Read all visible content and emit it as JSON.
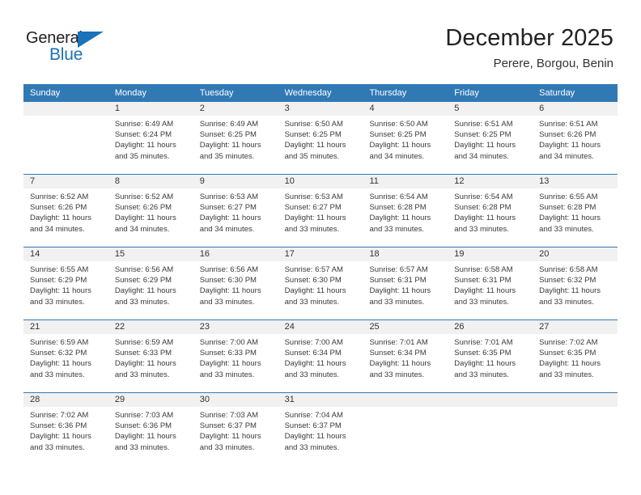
{
  "logo": {
    "word_one": "General",
    "word_two": "Blue",
    "triangle_icon": "blue-triangle-icon",
    "accent_color": "#1a72b8",
    "dark_color": "#231f20"
  },
  "header": {
    "title": "December 2025",
    "subtitle": "Perere, Borgou, Benin"
  },
  "calendar": {
    "header_bg": "#3179b5",
    "day_number_bg": "#f1f1f1",
    "weekdays": [
      "Sunday",
      "Monday",
      "Tuesday",
      "Wednesday",
      "Thursday",
      "Friday",
      "Saturday"
    ],
    "weeks": [
      [
        {
          "day": "",
          "empty": true,
          "sunrise": "",
          "sunset": "",
          "daylight": ""
        },
        {
          "day": "1",
          "empty": false,
          "sunrise": "Sunrise: 6:49 AM",
          "sunset": "Sunset: 6:24 PM",
          "daylight": "Daylight: 11 hours and 35 minutes."
        },
        {
          "day": "2",
          "empty": false,
          "sunrise": "Sunrise: 6:49 AM",
          "sunset": "Sunset: 6:25 PM",
          "daylight": "Daylight: 11 hours and 35 minutes."
        },
        {
          "day": "3",
          "empty": false,
          "sunrise": "Sunrise: 6:50 AM",
          "sunset": "Sunset: 6:25 PM",
          "daylight": "Daylight: 11 hours and 35 minutes."
        },
        {
          "day": "4",
          "empty": false,
          "sunrise": "Sunrise: 6:50 AM",
          "sunset": "Sunset: 6:25 PM",
          "daylight": "Daylight: 11 hours and 34 minutes."
        },
        {
          "day": "5",
          "empty": false,
          "sunrise": "Sunrise: 6:51 AM",
          "sunset": "Sunset: 6:25 PM",
          "daylight": "Daylight: 11 hours and 34 minutes."
        },
        {
          "day": "6",
          "empty": false,
          "sunrise": "Sunrise: 6:51 AM",
          "sunset": "Sunset: 6:26 PM",
          "daylight": "Daylight: 11 hours and 34 minutes."
        }
      ],
      [
        {
          "day": "7",
          "empty": false,
          "sunrise": "Sunrise: 6:52 AM",
          "sunset": "Sunset: 6:26 PM",
          "daylight": "Daylight: 11 hours and 34 minutes."
        },
        {
          "day": "8",
          "empty": false,
          "sunrise": "Sunrise: 6:52 AM",
          "sunset": "Sunset: 6:26 PM",
          "daylight": "Daylight: 11 hours and 34 minutes."
        },
        {
          "day": "9",
          "empty": false,
          "sunrise": "Sunrise: 6:53 AM",
          "sunset": "Sunset: 6:27 PM",
          "daylight": "Daylight: 11 hours and 34 minutes."
        },
        {
          "day": "10",
          "empty": false,
          "sunrise": "Sunrise: 6:53 AM",
          "sunset": "Sunset: 6:27 PM",
          "daylight": "Daylight: 11 hours and 33 minutes."
        },
        {
          "day": "11",
          "empty": false,
          "sunrise": "Sunrise: 6:54 AM",
          "sunset": "Sunset: 6:28 PM",
          "daylight": "Daylight: 11 hours and 33 minutes."
        },
        {
          "day": "12",
          "empty": false,
          "sunrise": "Sunrise: 6:54 AM",
          "sunset": "Sunset: 6:28 PM",
          "daylight": "Daylight: 11 hours and 33 minutes."
        },
        {
          "day": "13",
          "empty": false,
          "sunrise": "Sunrise: 6:55 AM",
          "sunset": "Sunset: 6:28 PM",
          "daylight": "Daylight: 11 hours and 33 minutes."
        }
      ],
      [
        {
          "day": "14",
          "empty": false,
          "sunrise": "Sunrise: 6:55 AM",
          "sunset": "Sunset: 6:29 PM",
          "daylight": "Daylight: 11 hours and 33 minutes."
        },
        {
          "day": "15",
          "empty": false,
          "sunrise": "Sunrise: 6:56 AM",
          "sunset": "Sunset: 6:29 PM",
          "daylight": "Daylight: 11 hours and 33 minutes."
        },
        {
          "day": "16",
          "empty": false,
          "sunrise": "Sunrise: 6:56 AM",
          "sunset": "Sunset: 6:30 PM",
          "daylight": "Daylight: 11 hours and 33 minutes."
        },
        {
          "day": "17",
          "empty": false,
          "sunrise": "Sunrise: 6:57 AM",
          "sunset": "Sunset: 6:30 PM",
          "daylight": "Daylight: 11 hours and 33 minutes."
        },
        {
          "day": "18",
          "empty": false,
          "sunrise": "Sunrise: 6:57 AM",
          "sunset": "Sunset: 6:31 PM",
          "daylight": "Daylight: 11 hours and 33 minutes."
        },
        {
          "day": "19",
          "empty": false,
          "sunrise": "Sunrise: 6:58 AM",
          "sunset": "Sunset: 6:31 PM",
          "daylight": "Daylight: 11 hours and 33 minutes."
        },
        {
          "day": "20",
          "empty": false,
          "sunrise": "Sunrise: 6:58 AM",
          "sunset": "Sunset: 6:32 PM",
          "daylight": "Daylight: 11 hours and 33 minutes."
        }
      ],
      [
        {
          "day": "21",
          "empty": false,
          "sunrise": "Sunrise: 6:59 AM",
          "sunset": "Sunset: 6:32 PM",
          "daylight": "Daylight: 11 hours and 33 minutes."
        },
        {
          "day": "22",
          "empty": false,
          "sunrise": "Sunrise: 6:59 AM",
          "sunset": "Sunset: 6:33 PM",
          "daylight": "Daylight: 11 hours and 33 minutes."
        },
        {
          "day": "23",
          "empty": false,
          "sunrise": "Sunrise: 7:00 AM",
          "sunset": "Sunset: 6:33 PM",
          "daylight": "Daylight: 11 hours and 33 minutes."
        },
        {
          "day": "24",
          "empty": false,
          "sunrise": "Sunrise: 7:00 AM",
          "sunset": "Sunset: 6:34 PM",
          "daylight": "Daylight: 11 hours and 33 minutes."
        },
        {
          "day": "25",
          "empty": false,
          "sunrise": "Sunrise: 7:01 AM",
          "sunset": "Sunset: 6:34 PM",
          "daylight": "Daylight: 11 hours and 33 minutes."
        },
        {
          "day": "26",
          "empty": false,
          "sunrise": "Sunrise: 7:01 AM",
          "sunset": "Sunset: 6:35 PM",
          "daylight": "Daylight: 11 hours and 33 minutes."
        },
        {
          "day": "27",
          "empty": false,
          "sunrise": "Sunrise: 7:02 AM",
          "sunset": "Sunset: 6:35 PM",
          "daylight": "Daylight: 11 hours and 33 minutes."
        }
      ],
      [
        {
          "day": "28",
          "empty": false,
          "sunrise": "Sunrise: 7:02 AM",
          "sunset": "Sunset: 6:36 PM",
          "daylight": "Daylight: 11 hours and 33 minutes."
        },
        {
          "day": "29",
          "empty": false,
          "sunrise": "Sunrise: 7:03 AM",
          "sunset": "Sunset: 6:36 PM",
          "daylight": "Daylight: 11 hours and 33 minutes."
        },
        {
          "day": "30",
          "empty": false,
          "sunrise": "Sunrise: 7:03 AM",
          "sunset": "Sunset: 6:37 PM",
          "daylight": "Daylight: 11 hours and 33 minutes."
        },
        {
          "day": "31",
          "empty": false,
          "sunrise": "Sunrise: 7:04 AM",
          "sunset": "Sunset: 6:37 PM",
          "daylight": "Daylight: 11 hours and 33 minutes."
        },
        {
          "day": "",
          "empty": true,
          "sunrise": "",
          "sunset": "",
          "daylight": ""
        },
        {
          "day": "",
          "empty": true,
          "sunrise": "",
          "sunset": "",
          "daylight": ""
        },
        {
          "day": "",
          "empty": true,
          "sunrise": "",
          "sunset": "",
          "daylight": ""
        }
      ]
    ]
  }
}
